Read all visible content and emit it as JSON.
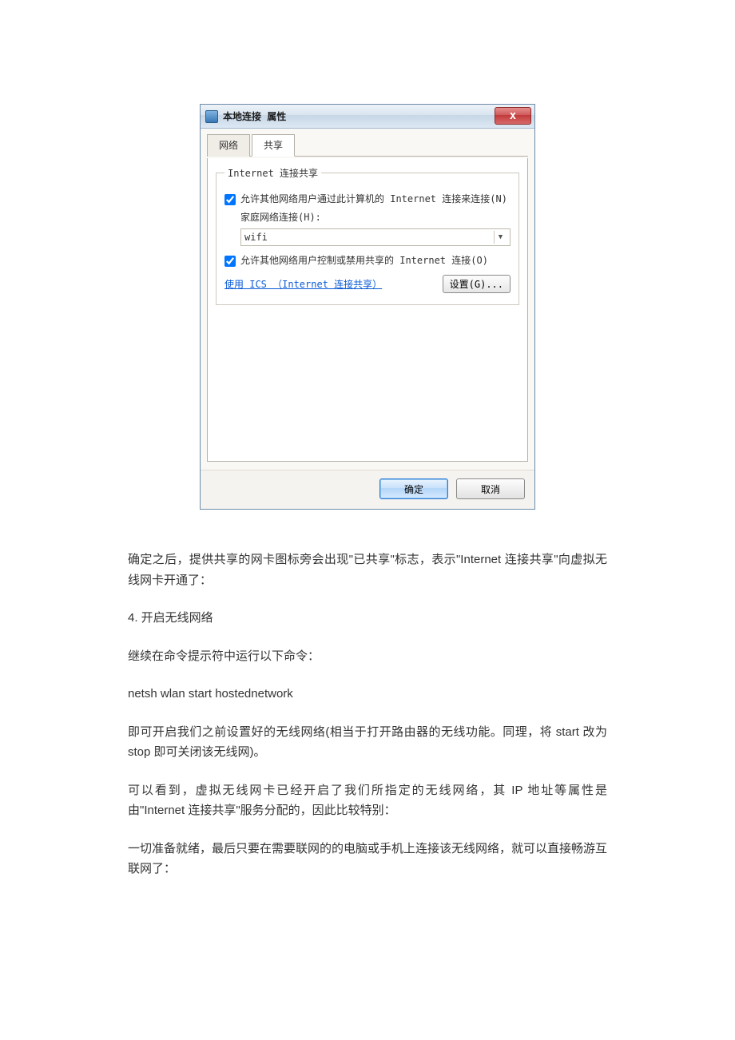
{
  "dialog": {
    "title": "本地连接 属性",
    "close_label": "x",
    "tabs": {
      "network": "网络",
      "share": "共享"
    },
    "group_legend": "Internet 连接共享",
    "checkbox1": "允许其他网络用户通过此计算机的 Internet 连接来连接(N)",
    "home_net_label": "家庭网络连接(H):",
    "combo_value": "wifi",
    "checkbox2": "允许其他网络用户控制或禁用共享的 Internet 连接(O)",
    "ics_link": "使用 ICS （Internet 连接共享）",
    "settings_btn": "设置(G)...",
    "ok_btn": "确定",
    "cancel_btn": "取消"
  },
  "article": {
    "p1": "确定之后，提供共享的网卡图标旁会出现\"已共享\"标志，表示\"Internet 连接共享\"向虚拟无线网卡开通了：",
    "p2": "4. 开启无线网络",
    "p3": "继续在命令提示符中运行以下命令：",
    "p4": "netsh wlan start hostednetwork",
    "p5": "即可开启我们之前设置好的无线网络(相当于打开路由器的无线功能。同理，将 start 改为 stop 即可关闭该无线网)。",
    "p6": "可以看到，虚拟无线网卡已经开启了我们所指定的无线网络，其 IP 地址等属性是由\"Internet 连接共享\"服务分配的，因此比较特别：",
    "p7": "一切准备就绪，最后只要在需要联网的的电脑或手机上连接该无线网络，就可以直接畅游互联网了："
  }
}
